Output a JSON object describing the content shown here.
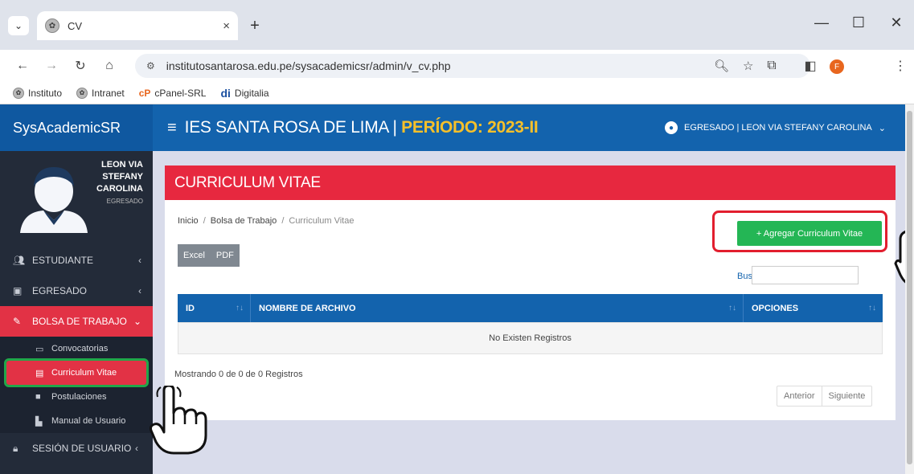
{
  "browser": {
    "tab_title": "CV",
    "tab_close": "×",
    "new_tab": "+",
    "url": "institutosantarosa.edu.pe/sysacademicsr/admin/v_cv.php",
    "profile_initial": "F",
    "bookmarks": [
      {
        "label": "Instituto",
        "icon": "institute-favicon"
      },
      {
        "label": "Intranet",
        "icon": "institute-favicon"
      },
      {
        "label": "cPanel-SRL",
        "icon": "cpanel-icon"
      },
      {
        "label": "Digitalia",
        "icon": "digitalia-icon"
      }
    ]
  },
  "app": {
    "brand": "SysAcademicSR",
    "institution": "IES SANTA ROSA DE LIMA | ",
    "period": "PERÍODO: 2023-II",
    "user_label": "EGRESADO | LEON VIA STEFANY CAROLINA",
    "accent_color": "#e7283f",
    "primary_color": "#1363ad",
    "success_color": "#24b655"
  },
  "sidebar": {
    "profile_name": "LEON VIA STEFANY CAROLINA",
    "profile_role": "EGRESADO",
    "menu": [
      {
        "label": "ESTUDIANTE",
        "icon": "users-icon"
      },
      {
        "label": "EGRESADO",
        "icon": "graduate-icon"
      },
      {
        "label": "BOLSA DE TRABAJO",
        "icon": "edit-icon"
      }
    ],
    "submenu": [
      {
        "label": "Convocatorias",
        "icon": "image-icon"
      },
      {
        "label": "Curriculum Vitae",
        "icon": "id-card-icon"
      },
      {
        "label": "Postulaciones",
        "icon": "briefcase-icon"
      },
      {
        "label": "Manual de Usuario",
        "icon": "manual-icon"
      }
    ],
    "session": {
      "label": "SESIÓN DE USUARIO",
      "icon": "lock-icon"
    }
  },
  "main": {
    "panel_title": "CURRICULUM VITAE",
    "breadcrumb": [
      "Inicio",
      "Bolsa de Trabajo",
      "Curriculum Vitae"
    ],
    "add_button": "+ Agregar Curriculum Vitae",
    "export_buttons": [
      "Excel",
      "PDF"
    ],
    "search_label": "Buscar:",
    "search_value": "",
    "table": {
      "columns": [
        "ID",
        "NOMBRE DE ARCHIVO",
        "OPCIONES"
      ],
      "empty_message": "No Existen Registros"
    },
    "info": "Mostrando 0 de 0 de 0 Registros",
    "pager": {
      "prev": "Anterior",
      "next": "Siguiente"
    }
  }
}
